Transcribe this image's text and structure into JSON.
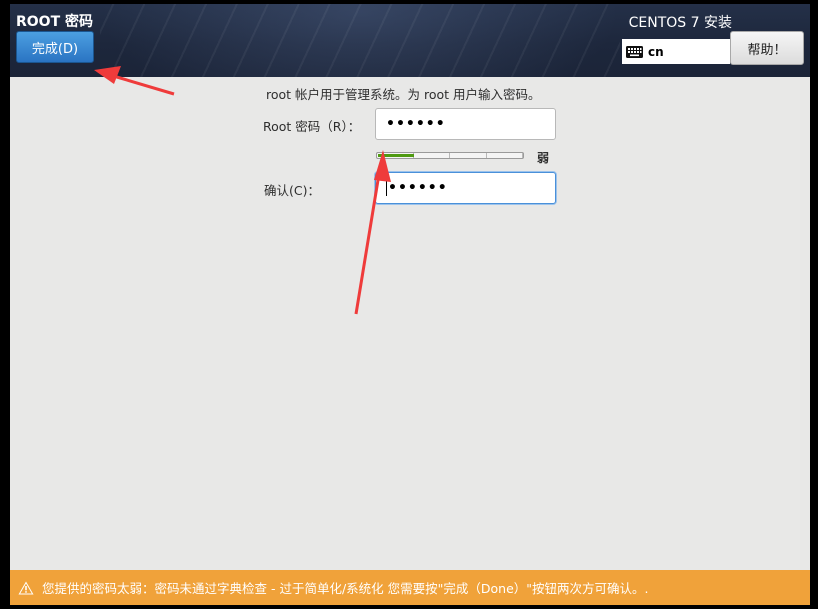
{
  "header": {
    "spoke_title": "ROOT 密码",
    "done_label": "完成(D)",
    "product_title": "CENTOS 7 安装",
    "keyboard_layout": "cn",
    "help_label": "帮助！"
  },
  "form": {
    "description": "root 帐户用于管理系统。为 root 用户输入密码。",
    "password_label": "Root 密码（R）：",
    "password_value": "••••••",
    "confirm_label": "确认(C)：",
    "confirm_value": "••••••",
    "strength_label": "弱",
    "strength_fraction": 0.25
  },
  "warning": {
    "text": "您提供的密码太弱：密码未通过字典检查 - 过于简单化/系统化 您需要按\"完成（Done）\"按钮两次方可确认。."
  },
  "colors": {
    "header_bg": "#1d273c",
    "done_button": "#2a74c3",
    "warning_bg": "#f0a23a",
    "strength_fill": "#4f9a12",
    "annotation_arrow": "#ef3b3b"
  },
  "icons": {
    "keyboard": "keyboard-icon",
    "warning": "warning-icon"
  }
}
